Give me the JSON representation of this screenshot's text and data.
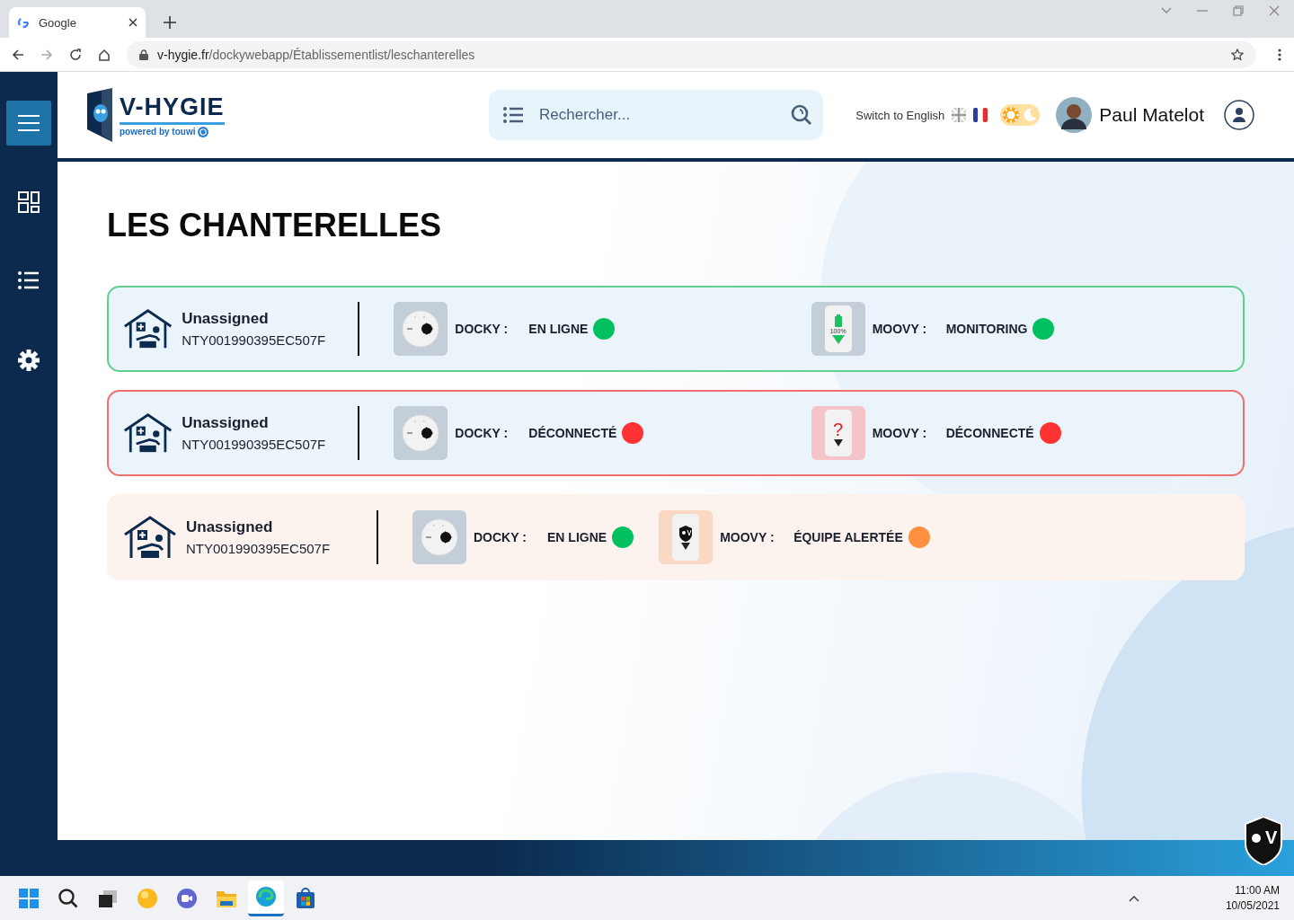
{
  "browser": {
    "tab_title": "Google",
    "url_host": "v-hygie.fr",
    "url_path": "/dockywebapp/Établissementlist/leschanterelles"
  },
  "header": {
    "logo_text": "V-HYGIE",
    "logo_tagline": "powered by touwi",
    "search": {
      "placeholder": "Rechercher..."
    },
    "language_link": "Switch to English",
    "theme": {
      "dark": false
    },
    "user_name": "Paul Matelot"
  },
  "sidebar": {
    "items": [
      {
        "kind": "menu",
        "selected": true
      },
      {
        "kind": "dashboard",
        "selected": false
      },
      {
        "kind": "list",
        "selected": false
      },
      {
        "kind": "settings",
        "selected": false
      }
    ]
  },
  "page_title": "LES CHANTERELLES",
  "rooms": [
    {
      "kind": "ok",
      "name": "Unassigned",
      "serial": "NTY001990395EC507F",
      "docky": {
        "label": "DOCKY :",
        "status": "EN LIGNE",
        "color": "#00c060"
      },
      "moovy": {
        "kind": "battery",
        "battery": "100%",
        "label": "MOOVY :",
        "status": "MONITORING",
        "color": "#00c060"
      }
    },
    {
      "kind": "error",
      "name": "Unassigned",
      "serial": "NTY001990395EC507F",
      "docky": {
        "label": "DOCKY :",
        "status": "DÉCONNECTÉ",
        "color": "#ff3333"
      },
      "moovy": {
        "kind": "unknown",
        "mark": "?",
        "label": "MOOVY :",
        "status": "DÉCONNECTÉ",
        "color": "#ff3333"
      }
    },
    {
      "kind": "alert",
      "name": "Unassigned",
      "serial": "NTY001990395EC507F",
      "docky": {
        "label": "DOCKY :",
        "status": "EN LIGNE",
        "color": "#00c060"
      },
      "moovy": {
        "kind": "alert",
        "label": "MOOVY :",
        "status": "ÉQUIPE ALERTÉE",
        "color": "#ff9040"
      }
    }
  ],
  "corner_logo": {
    "letter": "V"
  },
  "taskbar": {
    "apps": [
      {
        "kind": "start",
        "selected": false
      },
      {
        "kind": "search",
        "selected": false
      },
      {
        "kind": "taskview",
        "selected": false
      },
      {
        "kind": "ball",
        "selected": false
      },
      {
        "kind": "chat",
        "selected": false
      },
      {
        "kind": "folder",
        "selected": false
      },
      {
        "kind": "browser",
        "selected": true
      },
      {
        "kind": "store",
        "selected": false
      }
    ],
    "time": "11:00 AM",
    "date": "10/05/2021"
  }
}
